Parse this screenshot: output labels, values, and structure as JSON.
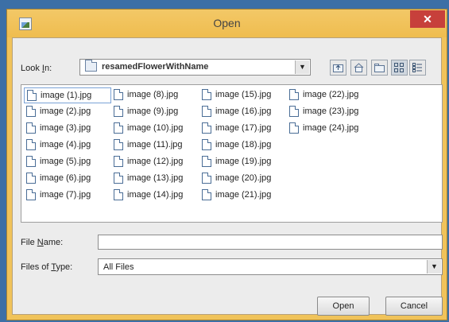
{
  "window": {
    "title": "Open",
    "close_glyph": "✕"
  },
  "look_in": {
    "label_pre": "Look ",
    "label_mnemonic": "I",
    "label_post": "n:",
    "value": "resamedFlowerWithName"
  },
  "toolbar": [
    {
      "name": "up-one-level",
      "icon": "up-folder-icon"
    },
    {
      "name": "home",
      "icon": "home-icon"
    },
    {
      "name": "new-folder",
      "icon": "new-folder-icon"
    },
    {
      "name": "list-view",
      "icon": "list-view-icon",
      "selected": true
    },
    {
      "name": "details-view",
      "icon": "details-view-icon"
    }
  ],
  "files": [
    [
      "image (1).jpg",
      "image (2).jpg",
      "image (3).jpg",
      "image (4).jpg",
      "image (5).jpg",
      "image (6).jpg",
      "image (7).jpg"
    ],
    [
      "image (8).jpg",
      "image (9).jpg",
      "image (10).jpg",
      "image (11).jpg",
      "image (12).jpg",
      "image (13).jpg",
      "image (14).jpg"
    ],
    [
      "image (15).jpg",
      "image (16).jpg",
      "image (17).jpg",
      "image (18).jpg",
      "image (19).jpg",
      "image (20).jpg",
      "image (21).jpg"
    ],
    [
      "image (22).jpg",
      "image (23).jpg",
      "image (24).jpg"
    ]
  ],
  "file_name": {
    "label_pre": "File ",
    "label_mnemonic": "N",
    "label_post": "ame:",
    "value": "",
    "placeholder": ""
  },
  "file_type": {
    "label_pre": "Files of ",
    "label_mnemonic": "T",
    "label_post": "ype:",
    "value": "All Files"
  },
  "buttons": {
    "open": "Open",
    "cancel": "Cancel"
  },
  "colors": {
    "title_bar": "#f0c35a",
    "close": "#c7403b",
    "dialog_bg": "#ececec"
  }
}
